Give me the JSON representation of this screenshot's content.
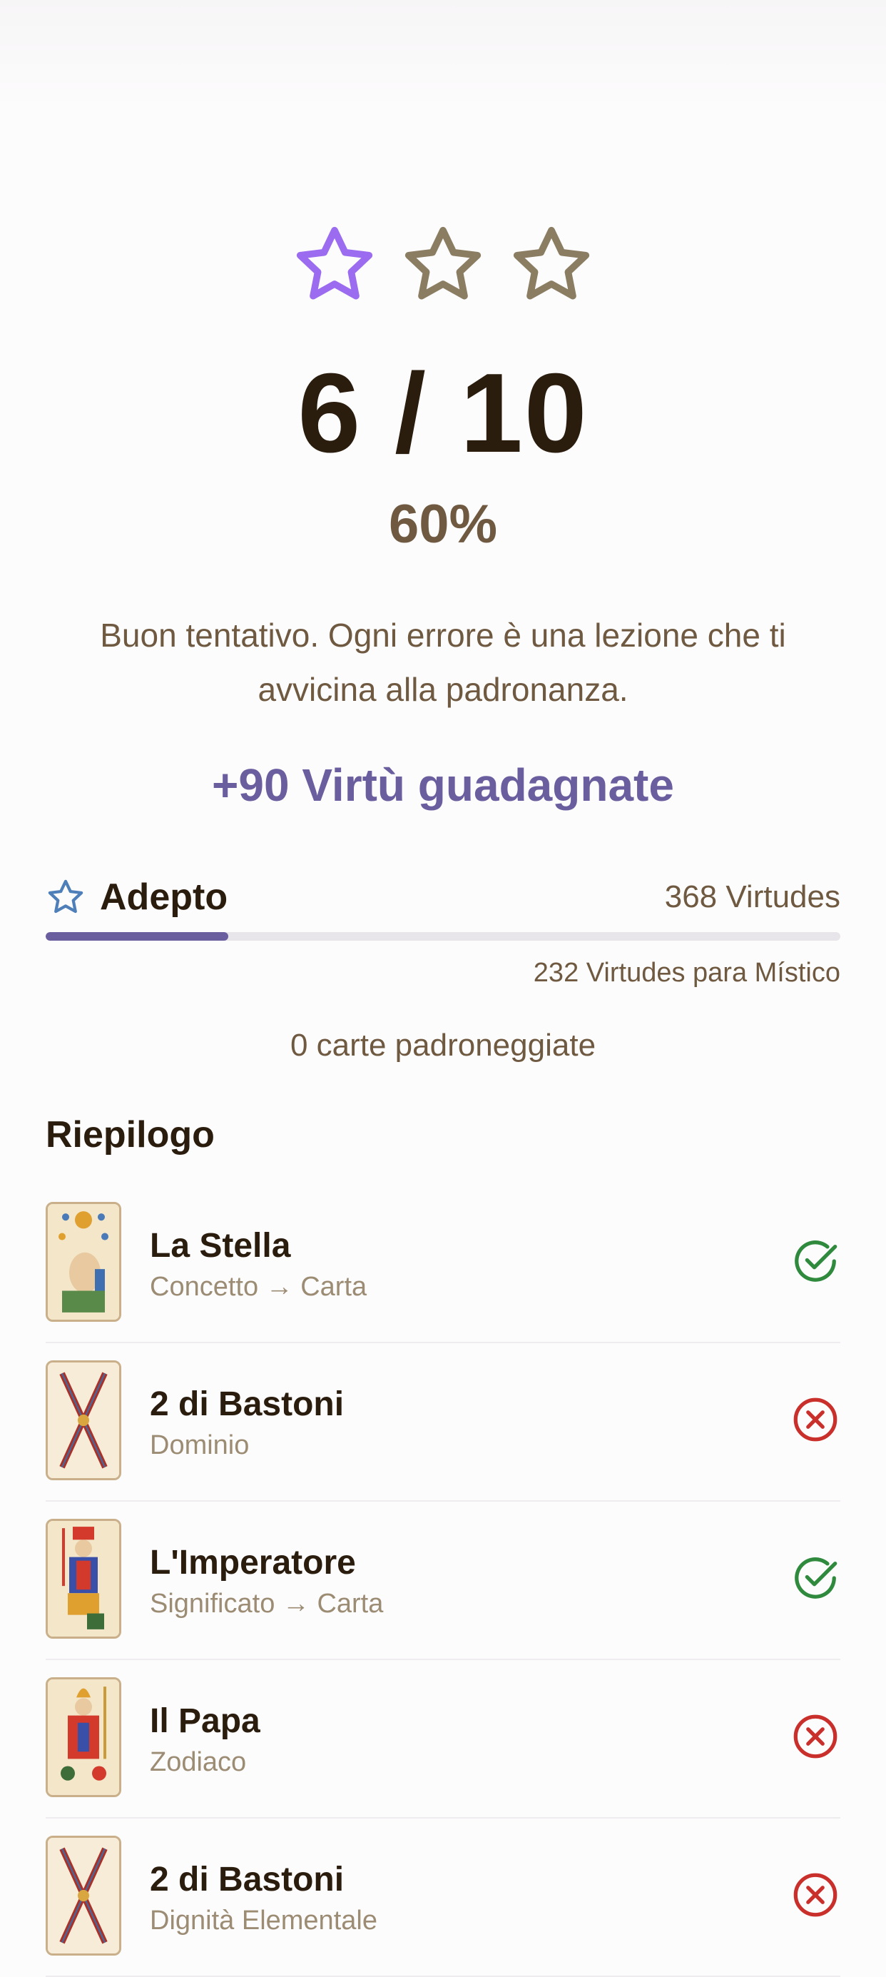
{
  "colors": {
    "star_active": "#9b6bf0",
    "star_inactive": "#8b7d62",
    "accent": "#6b5e9f",
    "correct": "#2f8a3e",
    "wrong": "#c9302c",
    "level_star": "#4e7fb8"
  },
  "rating": {
    "stars_total": 3,
    "stars_earned": 1
  },
  "result": {
    "score": "6 / 10",
    "percent": "60%",
    "message": "Buon tentativo. Ogni errore è una lezione che ti avvicina alla padronanza.",
    "virtues_earned": "+90 Virtù guadagnate"
  },
  "level": {
    "icon": "star-outline-icon",
    "name": "Adepto",
    "virtues": "368 Virtudes",
    "progress_fraction": 0.23,
    "next_level_text": "232 Virtudes para Místico"
  },
  "mastered_text": "0 carte padroneggiate",
  "summary": {
    "title": "Riepilogo",
    "items": [
      {
        "name": "La Stella",
        "type": "Concetto → Carta",
        "correct": true,
        "thumb_icon": "star-card-thumbnail"
      },
      {
        "name": "2 di Bastoni",
        "type": "Dominio",
        "correct": false,
        "thumb_icon": "batons-card-thumbnail"
      },
      {
        "name": "L'Imperatore",
        "type": "Significato → Carta",
        "correct": true,
        "thumb_icon": "emperor-card-thumbnail"
      },
      {
        "name": "Il Papa",
        "type": "Zodiaco",
        "correct": false,
        "thumb_icon": "pope-card-thumbnail"
      },
      {
        "name": "2 di Bastoni",
        "type": "Dignità Elementale",
        "correct": false,
        "thumb_icon": "batons-card-thumbnail"
      }
    ]
  }
}
